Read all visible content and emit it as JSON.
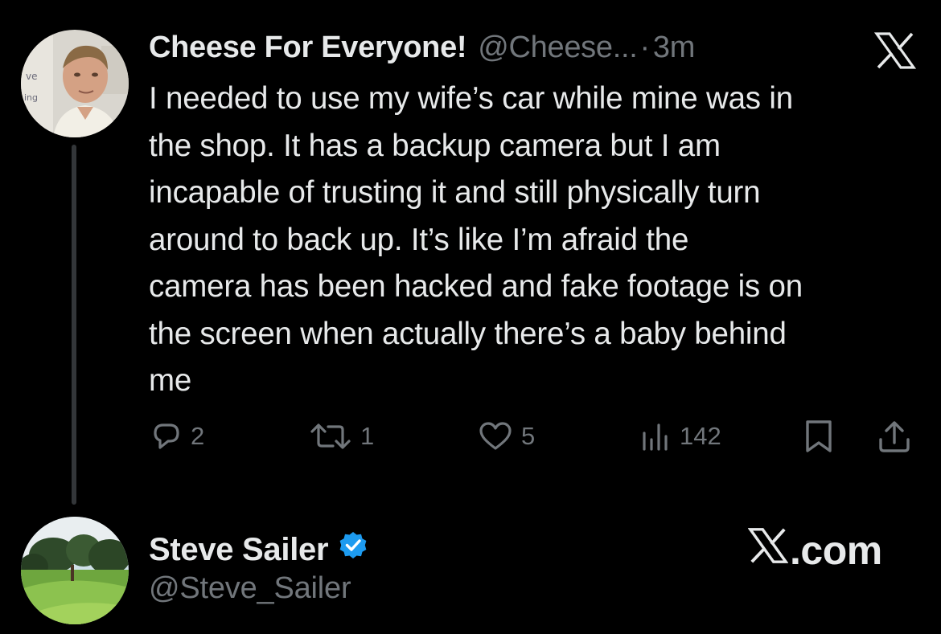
{
  "tweet": {
    "display_name": "Cheese For Everyone!",
    "handle": "@Cheese...",
    "separator": "·",
    "time": "3m",
    "text": "I needed to use my wife’s car while mine was in\nthe shop. It has a backup camera but I am\nincapable of trusting it and still physically turn\naround to back up. It’s like I’m afraid the\ncamera has been hacked and fake footage is on\nthe screen when actually there’s a baby behind\nme",
    "actions": {
      "replies": "2",
      "reposts": "1",
      "likes": "5",
      "views": "142"
    }
  },
  "author": {
    "name": "Steve Sailer",
    "handle": "@Steve_Sailer",
    "verified": true
  },
  "branding": {
    "site": ".com",
    "logo": "x-logo-icon"
  },
  "colors": {
    "background": "#000000",
    "text_primary": "#e7e9ea",
    "text_secondary": "#71767b",
    "verified_blue": "#1d9bf0",
    "thread_line": "#333639"
  }
}
